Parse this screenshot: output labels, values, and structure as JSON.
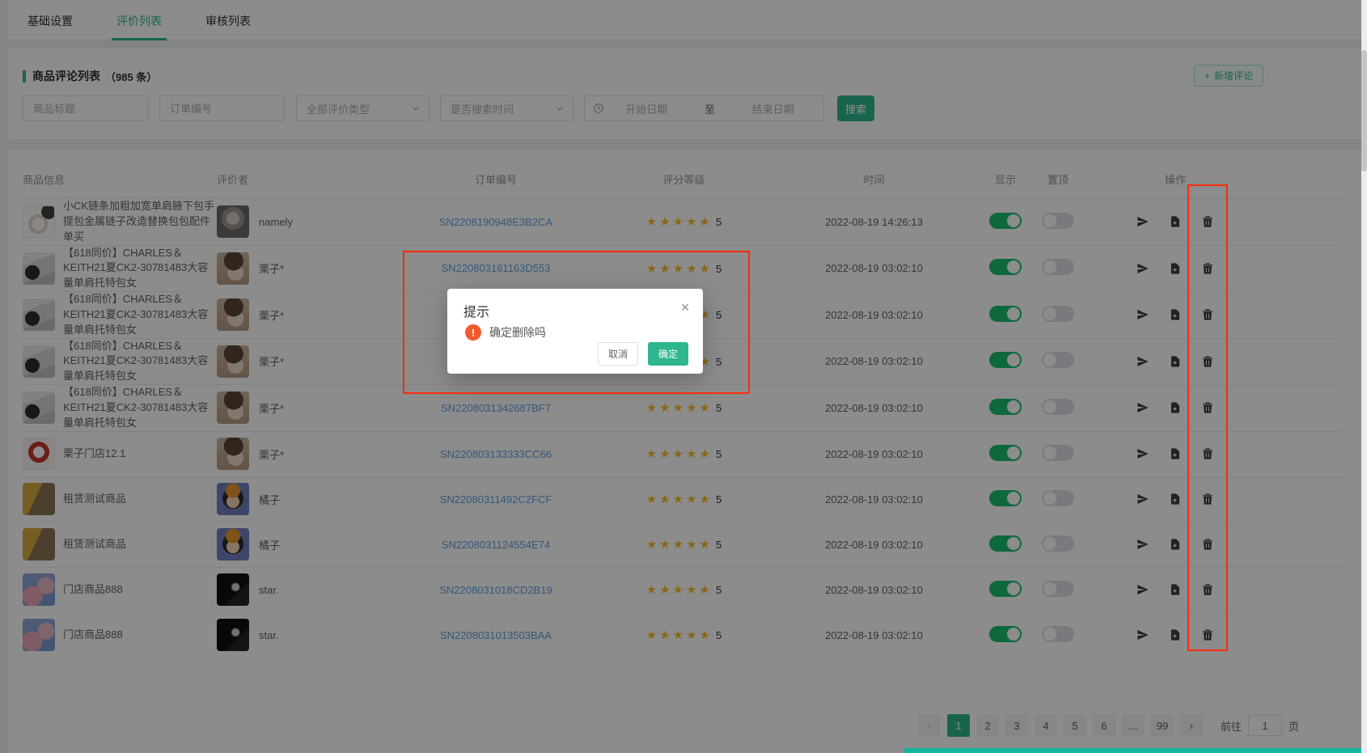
{
  "colors": {
    "theme_green": "#2fb68f",
    "toggle_on": "#1dbd6e",
    "star_gold": "#f7ba2a",
    "link_blue": "#5e9fe0",
    "annotation_red": "#fa2b0a",
    "warning_orange": "#f4582c"
  },
  "icons": {
    "plus": "+",
    "close": "✕",
    "warning": "!",
    "star": "★",
    "prev": "‹",
    "next": "›"
  },
  "tabs": [
    {
      "label": "基础设置",
      "active": false
    },
    {
      "label": "评价列表",
      "active": true
    },
    {
      "label": "审核列表",
      "active": false
    }
  ],
  "list_header": {
    "title": "商品评论列表",
    "count": "（985 条）",
    "add_label": "新增评论"
  },
  "filters": {
    "product_placeholder": "商品标题",
    "order_placeholder": "订单编号",
    "review_type_value": "全部评价类型",
    "time_search_value": "是否搜索时间",
    "date_start": "开始日期",
    "date_separator": "至",
    "date_end": "结束日期",
    "search_label": "搜索"
  },
  "table": {
    "columns": [
      "商品信息",
      "评价者",
      "订单编号",
      "评分等级",
      "时间",
      "显示",
      "置顶",
      "操作"
    ],
    "rows": [
      {
        "product": "小CK链条加粗加宽单肩腋下包手提包金属链子改造替换包包配件单买",
        "thumb": "t-necklace",
        "reviewer": "namely",
        "avatar": "a-cat",
        "order": "SN2208190948E3B2CA",
        "rating": 5,
        "rating_text": "5",
        "time": "2022-08-19 14:26:13",
        "show_on": true,
        "pinned": false
      },
      {
        "product": "【618同价】CHARLES＆KEITH21夏CK2-30781483大容量单肩托特包女",
        "thumb": "t-ck",
        "reviewer": "栗子*",
        "avatar": "a-chestnut",
        "order": "SN220803161163D553",
        "rating": 5,
        "rating_text": "5",
        "time": "2022-08-19 03:02:10",
        "show_on": true,
        "pinned": false
      },
      {
        "product": "【618同价】CHARLES＆KEITH21夏CK2-30781483大容量单肩托特包女",
        "thumb": "t-ck",
        "reviewer": "栗子*",
        "avatar": "a-chestnut",
        "order": "",
        "rating": 5,
        "rating_text": "5",
        "time": "2022-08-19 03:02:10",
        "show_on": true,
        "pinned": false
      },
      {
        "product": "【618同价】CHARLES＆KEITH21夏CK2-30781483大容量单肩托特包女",
        "thumb": "t-ck",
        "reviewer": "栗子*",
        "avatar": "a-chestnut",
        "order": "",
        "rating": 5,
        "rating_text": "5",
        "time": "2022-08-19 03:02:10",
        "show_on": true,
        "pinned": false
      },
      {
        "product": "【618同价】CHARLES＆KEITH21夏CK2-30781483大容量单肩托特包女",
        "thumb": "t-ck",
        "reviewer": "栗子*",
        "avatar": "a-chestnut",
        "order": "SN2208031342687BF7",
        "rating": 5,
        "rating_text": "5",
        "time": "2022-08-19 03:02:10",
        "show_on": true,
        "pinned": false
      },
      {
        "product": "栗子门店12.1",
        "thumb": "t-rabbit",
        "reviewer": "栗子*",
        "avatar": "a-chestnut",
        "order": "SN220803133333CC66",
        "rating": 5,
        "rating_text": "5",
        "time": "2022-08-19 03:02:10",
        "show_on": true,
        "pinned": false
      },
      {
        "product": "租赁测试商品",
        "thumb": "t-sand",
        "reviewer": "橘子",
        "avatar": "a-maruko",
        "order": "SN22080311492C2FCF",
        "rating": 5,
        "rating_text": "5",
        "time": "2022-08-19 03:02:10",
        "show_on": true,
        "pinned": false
      },
      {
        "product": "租赁测试商品",
        "thumb": "t-sand",
        "reviewer": "橘子",
        "avatar": "a-maruko",
        "order": "SN2208031124554E74",
        "rating": 5,
        "rating_text": "5",
        "time": "2022-08-19 03:02:10",
        "show_on": true,
        "pinned": false
      },
      {
        "product": "门店商品888",
        "thumb": "t-clouds",
        "reviewer": "star.",
        "avatar": "a-dark",
        "order": "SN2208031018CD2B19",
        "rating": 5,
        "rating_text": "5",
        "time": "2022-08-19 03:02:10",
        "show_on": true,
        "pinned": false
      },
      {
        "product": "门店商品888",
        "thumb": "t-clouds",
        "reviewer": "star.",
        "avatar": "a-dark",
        "order": "SN2208031013503BAA",
        "rating": 5,
        "rating_text": "5",
        "time": "2022-08-19 03:02:10",
        "show_on": true,
        "pinned": false
      }
    ]
  },
  "pagination": {
    "pages": [
      "1",
      "2",
      "3",
      "4",
      "5",
      "6",
      "...",
      "99"
    ],
    "active_page": "1",
    "goto_label": "前往",
    "goto_value": "1",
    "unit_label": "页"
  },
  "dialog": {
    "title": "提示",
    "message": "确定删除吗",
    "cancel_label": "取消",
    "confirm_label": "确定"
  }
}
